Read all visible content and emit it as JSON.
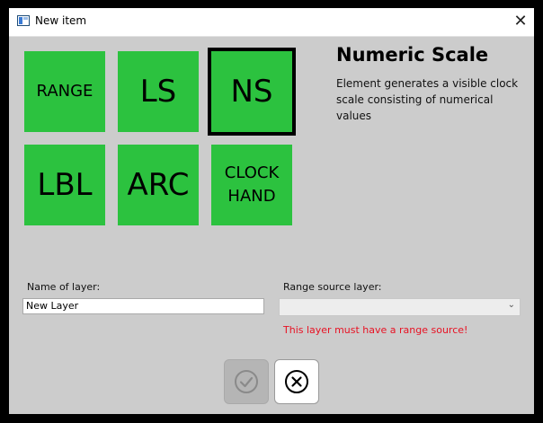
{
  "window": {
    "title": "New item",
    "close_glyph": "✕"
  },
  "tiles": [
    {
      "label": "RANGE",
      "selected": false
    },
    {
      "label": "LS",
      "selected": false
    },
    {
      "label": "NS",
      "selected": true
    },
    {
      "label": "LBL",
      "selected": false
    },
    {
      "label": "ARC",
      "selected": false
    },
    {
      "label": "CLOCK HAND",
      "selected": false
    }
  ],
  "description": {
    "title": "Numeric Scale",
    "text": "Element generates a visible clock scale consisting of numerical values"
  },
  "form": {
    "name_label": "Name of layer:",
    "name_value": "New Layer",
    "range_label": "Range source layer:",
    "range_value": "",
    "error": "This layer must have a range source!"
  },
  "buttons": {
    "ok_icon": "check-circle-icon",
    "cancel_icon": "x-circle-icon",
    "ok_enabled": false
  },
  "colors": {
    "tile_green": "#2cc23f",
    "background": "#cccccc",
    "error_red": "#e81123"
  }
}
